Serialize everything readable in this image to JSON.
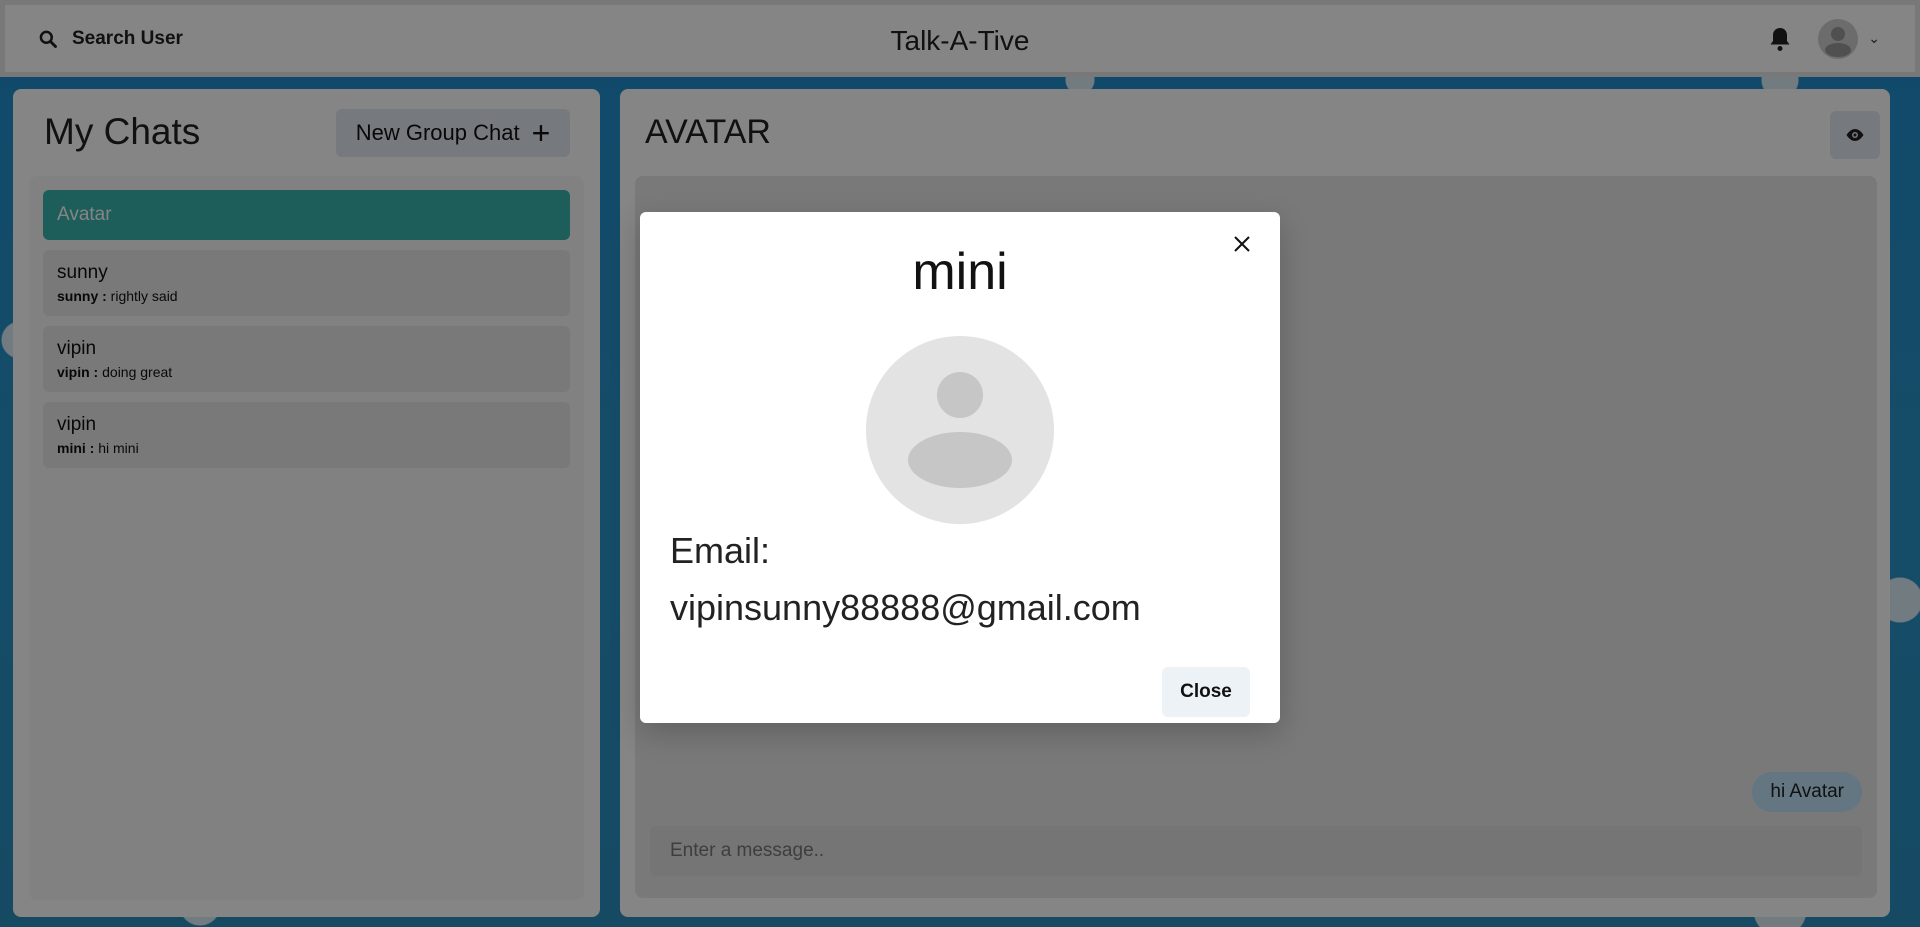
{
  "header": {
    "search_label": "Search User",
    "app_title": "Talk-A-Tive"
  },
  "left_panel": {
    "title": "My Chats",
    "new_group_label": "New Group Chat",
    "chats": [
      {
        "name": "Avatar",
        "active": true
      },
      {
        "name": "sunny",
        "sender": "sunny :",
        "preview": "rightly said"
      },
      {
        "name": "vipin",
        "sender": "vipin :",
        "preview": "doing great"
      },
      {
        "name": "vipin",
        "sender": "mini :",
        "preview": "hi mini"
      }
    ]
  },
  "chat": {
    "title": "AVATAR",
    "messages": [
      {
        "text": "hi Avatar"
      }
    ],
    "input_placeholder": "Enter a message.."
  },
  "modal": {
    "title": "mini",
    "email_label": "Email:",
    "email_value": "vipinsunny88888@gmail.com",
    "close_label": "Close"
  },
  "colors": {
    "active_chat": "#38b2ac",
    "bubble": "#bee3f8"
  }
}
